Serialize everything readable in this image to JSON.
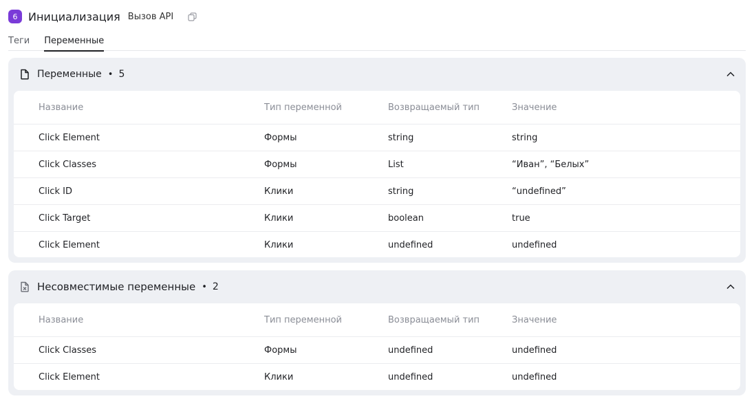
{
  "header": {
    "step_number": "6",
    "title": "Инициализация",
    "subtitle": "Вызов API",
    "copy_icon": "copy-icon"
  },
  "tabs": [
    {
      "label": "Теги",
      "active": false
    },
    {
      "label": "Переменные",
      "active": true
    }
  ],
  "sections": [
    {
      "title": "Переменные",
      "separator": "•",
      "count": "5",
      "icon": "file-icon",
      "expanded": true,
      "columns": [
        "Название",
        "Тип переменной",
        "Возвращаемый тип",
        "Значение"
      ],
      "rows": [
        [
          "Click Element",
          "Формы",
          "string",
          "string"
        ],
        [
          "Click Classes",
          "Формы",
          "List",
          "“Иван”, “Белых”"
        ],
        [
          "Click ID",
          "Клики",
          "string",
          "“undefined”"
        ],
        [
          "Click Target",
          "Клики",
          "boolean",
          "true"
        ],
        [
          "Click Element",
          "Клики",
          "undefined",
          "undefined"
        ]
      ]
    },
    {
      "title": "Несовместимые переменные",
      "separator": "•",
      "count": "2",
      "icon": "file-x-icon",
      "expanded": true,
      "columns": [
        "Название",
        "Тип переменной",
        "Возвращаемый тип",
        "Значение"
      ],
      "rows": [
        [
          "Click Classes",
          "Формы",
          "undefined",
          "undefined"
        ],
        [
          "Click Element",
          "Клики",
          "undefined",
          "undefined"
        ]
      ]
    }
  ],
  "colors": {
    "accent": "#7a3bd8",
    "section_bg": "#eef0f4",
    "header_text": "#8a8d96"
  }
}
